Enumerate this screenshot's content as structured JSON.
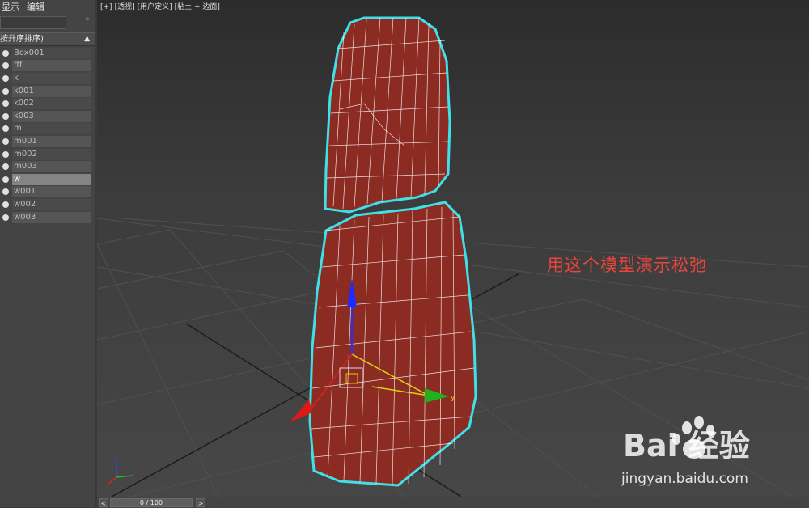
{
  "menu": {
    "display": "显示",
    "edit": "编辑"
  },
  "scene_explorer": {
    "search": {
      "placeholder": ""
    },
    "expand_icon": "double-chevron-right",
    "header_label": "按升序排序)",
    "sort_icon": "triangle-up",
    "items": [
      {
        "label": "Box001"
      },
      {
        "label": "fff"
      },
      {
        "label": "k"
      },
      {
        "label": "k001"
      },
      {
        "label": "k002"
      },
      {
        "label": "k003"
      },
      {
        "label": "m"
      },
      {
        "label": "m001"
      },
      {
        "label": "m002"
      },
      {
        "label": "m003"
      },
      {
        "label": "w",
        "selected": true
      },
      {
        "label": "w001"
      },
      {
        "label": "w002"
      },
      {
        "label": "w003"
      }
    ]
  },
  "viewport": {
    "labels": [
      "[+]",
      "[透视]",
      "[用户定义]",
      "[粘土 + 边面]"
    ],
    "annotation": "用这个模型演示松弛",
    "gizmo_axis_label": "y",
    "model_color": "#8b2b22",
    "wire_color": "#ffffff",
    "selection_color": "#3fe0e8"
  },
  "watermark": {
    "brand": "Bai 经验",
    "site": "jingyan.baidu.com"
  },
  "timeline": {
    "prev": "<",
    "next": ">",
    "frame": "0 / 100"
  }
}
